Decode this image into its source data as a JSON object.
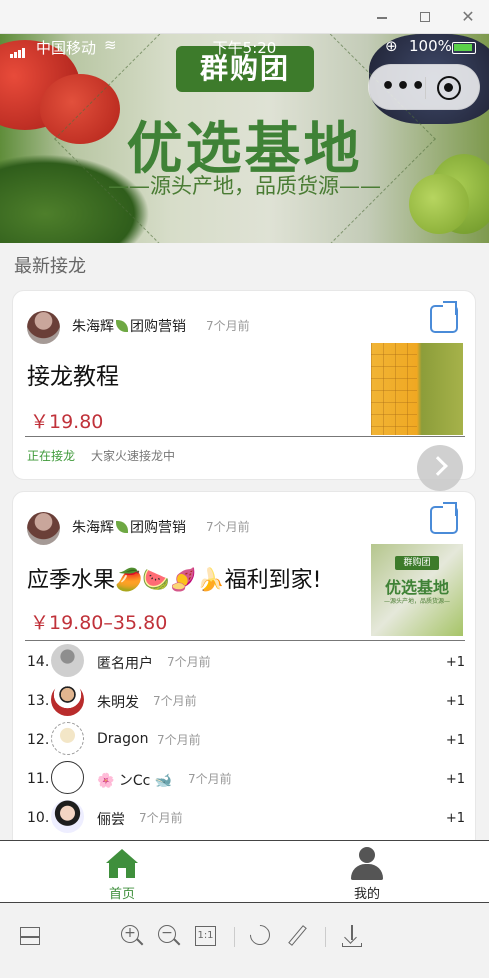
{
  "window": {
    "minimize": "—",
    "maximize": "",
    "close": "✕"
  },
  "status_bar": {
    "carrier": "中国移动",
    "wifi": "≋",
    "time": "下午5:20",
    "gps": "⊕",
    "battery": "100%"
  },
  "banner": {
    "badge": "群购团",
    "headline": "优选基地",
    "slogan": "——源头产地，品质货源——"
  },
  "capsule": {
    "more": "•••"
  },
  "section_title": "最新接龙",
  "cards": [
    {
      "poster_name": "朱海辉",
      "poster_suffix": "团购营销",
      "time": "7个月前",
      "title": "接龙教程",
      "price": "￥19.80",
      "status": "正在接龙",
      "status_sub": "大家火速接龙中"
    },
    {
      "poster_name": "朱海辉",
      "poster_suffix": "团购营销",
      "time": "7个月前",
      "title": "应季水果🥭🍉🍠🍌福利到家!",
      "price": "￥19.80–35.80",
      "thumb_badge": "群购团",
      "thumb_headline": "优选基地",
      "thumb_slogan": "—源头产地，品质货源—",
      "entries": [
        {
          "index": "14.",
          "name": "匿名用户",
          "time": "7个月前",
          "qty": "+1"
        },
        {
          "index": "13.",
          "name": "朱明发",
          "time": "7个月前",
          "qty": "+1"
        },
        {
          "index": "12.",
          "name": "Dragon",
          "time": "7个月前",
          "qty": "+1"
        },
        {
          "index": "11.",
          "name": "🌸 ンCc 🐋",
          "time": "7个月前",
          "qty": "+1"
        },
        {
          "index": "10.",
          "name": "俪尝",
          "time": "7个月前",
          "qty": "+1"
        }
      ]
    }
  ],
  "tabbar": {
    "home": "首页",
    "mine": "我的"
  },
  "colors": {
    "brand_green": "#3f8f3c",
    "price_red": "#c0323a",
    "link_blue": "#4a8bd8"
  }
}
